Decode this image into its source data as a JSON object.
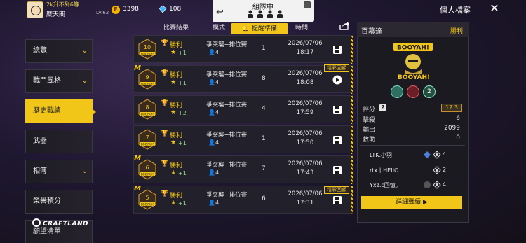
{
  "topbar": {
    "player_status": "2k升不到6等",
    "player_name": "糜天閣",
    "player_level": "LV.62",
    "coins": "3398",
    "diamonds": "108"
  },
  "team": {
    "label": "組隊中",
    "back_icon": "back-arrow-icon",
    "people_glyphs": "👤👤👤👤"
  },
  "reminder": {
    "label": "提醒準備"
  },
  "profile": {
    "title": "個人檔案"
  },
  "sidebar": {
    "items": [
      {
        "label": "總覽",
        "chevron": true
      },
      {
        "label": "戰鬥風格",
        "chevron": true
      },
      {
        "label": "歷史戰績",
        "chevron": false,
        "active": true
      },
      {
        "label": "武器",
        "chevron": false
      },
      {
        "label": "相簿",
        "chevron": true
      },
      {
        "label": "榮譽積分",
        "chevron": false
      },
      {
        "label": "願望清單",
        "chevron": false
      }
    ],
    "brand": "CRAFTLAND"
  },
  "table": {
    "headers": {
      "result": "比賽結果",
      "mode": "模式",
      "time": "時間"
    },
    "rows": [
      {
        "stars": "10",
        "result": "勝利",
        "star_delta": "+1",
        "mode": "爭突襲−排位賽",
        "squad": "4",
        "rank": "1",
        "date": "2026/07/06",
        "time": "18:17",
        "action": "save",
        "mvp": false,
        "highlight": false
      },
      {
        "stars": "9",
        "result": "勝利",
        "star_delta": "+1",
        "mode": "爭突襲−排位賽",
        "squad": "4",
        "rank": "8",
        "date": "2026/07/06",
        "time": "18:08",
        "action": "play",
        "mvp": true,
        "highlight": true
      },
      {
        "stars": "8",
        "result": "勝利",
        "star_delta": "+2",
        "mode": "爭突襲−排位賽",
        "squad": "4",
        "rank": "4",
        "date": "2026/07/06",
        "time": "17:59",
        "action": "save",
        "mvp": false,
        "highlight": false
      },
      {
        "stars": "7",
        "result": "勝利",
        "star_delta": "+1",
        "mode": "爭突襲−排位賽",
        "squad": "4",
        "rank": "1",
        "date": "2026/07/06",
        "time": "17:50",
        "action": "save",
        "mvp": false,
        "highlight": false
      },
      {
        "stars": "6",
        "result": "勝利",
        "star_delta": "+1",
        "mode": "爭突襲−排位賽",
        "squad": "4",
        "rank": "7",
        "date": "2026/07/06",
        "time": "17:43",
        "action": "save",
        "mvp": true,
        "highlight": false
      },
      {
        "stars": "5",
        "result": "勝利",
        "star_delta": "+1",
        "mode": "爭突襲−排位賽",
        "squad": "4",
        "rank": "6",
        "date": "2026/07/06",
        "time": "17:31",
        "action": "save",
        "mvp": true,
        "highlight": true
      }
    ],
    "highlight_label": "精彩回顧",
    "mvp_mark": "M",
    "emblem_caption": "BOOYAH!"
  },
  "detail": {
    "map_name": "百慕達",
    "result": "勝利",
    "banner_text": "BOOYAH!",
    "banner_caption": "BOOYAH!",
    "medal_count": "2",
    "stats": [
      {
        "label": "評分",
        "value": "12.3"
      },
      {
        "label": "擊殺",
        "value": "6"
      },
      {
        "label": "輸出",
        "value": "2099"
      },
      {
        "label": "救助",
        "value": "0"
      }
    ],
    "teammates": [
      {
        "name": "LTK.小羽",
        "count": "4"
      },
      {
        "name": "rtx丨HEIIO..",
        "count": "2"
      },
      {
        "name": "Yxz.c回憶。",
        "count": "4"
      }
    ],
    "detail_button": "詳細戰績 ▶"
  },
  "colors": {
    "accent": "#f2c619",
    "row_bg": "#22202a",
    "panel_bg": "#1c1a21",
    "positive": "#8de07c"
  }
}
